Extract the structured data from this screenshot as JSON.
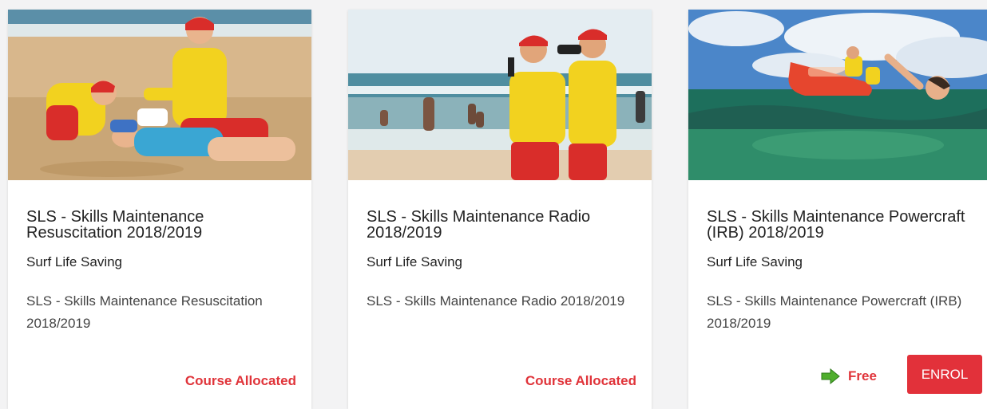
{
  "courses": [
    {
      "title": "SLS - Skills Maintenance Resuscitation 2018/2019",
      "provider": "Surf Life Saving",
      "description": "SLS - Skills Maintenance Resuscitation 2018/2019",
      "status": "Course Allocated"
    },
    {
      "title": "SLS - Skills Maintenance Radio 2018/2019",
      "provider": "Surf Life Saving",
      "description": "SLS - Skills Maintenance Radio 2018/2019",
      "status": "Course Allocated"
    },
    {
      "title": "SLS - Skills Maintenance Powercraft (IRB) 2018/2019",
      "provider": "Surf Life Saving",
      "description": "SLS - Skills Maintenance Powercraft (IRB) 2018/2019",
      "price": "Free",
      "price_icon": "green-arrow-right-icon",
      "action_label": "ENROL"
    }
  ],
  "colors": {
    "accent": "#e2313a",
    "lifesaver_yellow": "#f5d31c",
    "lifesaver_red": "#d92d2a",
    "free_arrow": "#4fae2d"
  }
}
